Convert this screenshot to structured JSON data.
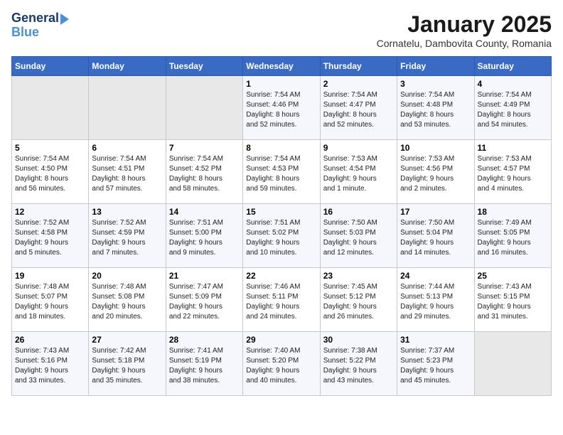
{
  "logo": {
    "line1": "General",
    "line2": "Blue"
  },
  "title": "January 2025",
  "subtitle": "Cornatelu, Dambovita County, Romania",
  "headers": [
    "Sunday",
    "Monday",
    "Tuesday",
    "Wednesday",
    "Thursday",
    "Friday",
    "Saturday"
  ],
  "weeks": [
    [
      {
        "day": "",
        "info": ""
      },
      {
        "day": "",
        "info": ""
      },
      {
        "day": "",
        "info": ""
      },
      {
        "day": "1",
        "info": "Sunrise: 7:54 AM\nSunset: 4:46 PM\nDaylight: 8 hours\nand 52 minutes."
      },
      {
        "day": "2",
        "info": "Sunrise: 7:54 AM\nSunset: 4:47 PM\nDaylight: 8 hours\nand 52 minutes."
      },
      {
        "day": "3",
        "info": "Sunrise: 7:54 AM\nSunset: 4:48 PM\nDaylight: 8 hours\nand 53 minutes."
      },
      {
        "day": "4",
        "info": "Sunrise: 7:54 AM\nSunset: 4:49 PM\nDaylight: 8 hours\nand 54 minutes."
      }
    ],
    [
      {
        "day": "5",
        "info": "Sunrise: 7:54 AM\nSunset: 4:50 PM\nDaylight: 8 hours\nand 56 minutes."
      },
      {
        "day": "6",
        "info": "Sunrise: 7:54 AM\nSunset: 4:51 PM\nDaylight: 8 hours\nand 57 minutes."
      },
      {
        "day": "7",
        "info": "Sunrise: 7:54 AM\nSunset: 4:52 PM\nDaylight: 8 hours\nand 58 minutes."
      },
      {
        "day": "8",
        "info": "Sunrise: 7:54 AM\nSunset: 4:53 PM\nDaylight: 8 hours\nand 59 minutes."
      },
      {
        "day": "9",
        "info": "Sunrise: 7:53 AM\nSunset: 4:54 PM\nDaylight: 9 hours\nand 1 minute."
      },
      {
        "day": "10",
        "info": "Sunrise: 7:53 AM\nSunset: 4:56 PM\nDaylight: 9 hours\nand 2 minutes."
      },
      {
        "day": "11",
        "info": "Sunrise: 7:53 AM\nSunset: 4:57 PM\nDaylight: 9 hours\nand 4 minutes."
      }
    ],
    [
      {
        "day": "12",
        "info": "Sunrise: 7:52 AM\nSunset: 4:58 PM\nDaylight: 9 hours\nand 5 minutes."
      },
      {
        "day": "13",
        "info": "Sunrise: 7:52 AM\nSunset: 4:59 PM\nDaylight: 9 hours\nand 7 minutes."
      },
      {
        "day": "14",
        "info": "Sunrise: 7:51 AM\nSunset: 5:00 PM\nDaylight: 9 hours\nand 9 minutes."
      },
      {
        "day": "15",
        "info": "Sunrise: 7:51 AM\nSunset: 5:02 PM\nDaylight: 9 hours\nand 10 minutes."
      },
      {
        "day": "16",
        "info": "Sunrise: 7:50 AM\nSunset: 5:03 PM\nDaylight: 9 hours\nand 12 minutes."
      },
      {
        "day": "17",
        "info": "Sunrise: 7:50 AM\nSunset: 5:04 PM\nDaylight: 9 hours\nand 14 minutes."
      },
      {
        "day": "18",
        "info": "Sunrise: 7:49 AM\nSunset: 5:05 PM\nDaylight: 9 hours\nand 16 minutes."
      }
    ],
    [
      {
        "day": "19",
        "info": "Sunrise: 7:48 AM\nSunset: 5:07 PM\nDaylight: 9 hours\nand 18 minutes."
      },
      {
        "day": "20",
        "info": "Sunrise: 7:48 AM\nSunset: 5:08 PM\nDaylight: 9 hours\nand 20 minutes."
      },
      {
        "day": "21",
        "info": "Sunrise: 7:47 AM\nSunset: 5:09 PM\nDaylight: 9 hours\nand 22 minutes."
      },
      {
        "day": "22",
        "info": "Sunrise: 7:46 AM\nSunset: 5:11 PM\nDaylight: 9 hours\nand 24 minutes."
      },
      {
        "day": "23",
        "info": "Sunrise: 7:45 AM\nSunset: 5:12 PM\nDaylight: 9 hours\nand 26 minutes."
      },
      {
        "day": "24",
        "info": "Sunrise: 7:44 AM\nSunset: 5:13 PM\nDaylight: 9 hours\nand 29 minutes."
      },
      {
        "day": "25",
        "info": "Sunrise: 7:43 AM\nSunset: 5:15 PM\nDaylight: 9 hours\nand 31 minutes."
      }
    ],
    [
      {
        "day": "26",
        "info": "Sunrise: 7:43 AM\nSunset: 5:16 PM\nDaylight: 9 hours\nand 33 minutes."
      },
      {
        "day": "27",
        "info": "Sunrise: 7:42 AM\nSunset: 5:18 PM\nDaylight: 9 hours\nand 35 minutes."
      },
      {
        "day": "28",
        "info": "Sunrise: 7:41 AM\nSunset: 5:19 PM\nDaylight: 9 hours\nand 38 minutes."
      },
      {
        "day": "29",
        "info": "Sunrise: 7:40 AM\nSunset: 5:20 PM\nDaylight: 9 hours\nand 40 minutes."
      },
      {
        "day": "30",
        "info": "Sunrise: 7:38 AM\nSunset: 5:22 PM\nDaylight: 9 hours\nand 43 minutes."
      },
      {
        "day": "31",
        "info": "Sunrise: 7:37 AM\nSunset: 5:23 PM\nDaylight: 9 hours\nand 45 minutes."
      },
      {
        "day": "",
        "info": ""
      }
    ]
  ]
}
